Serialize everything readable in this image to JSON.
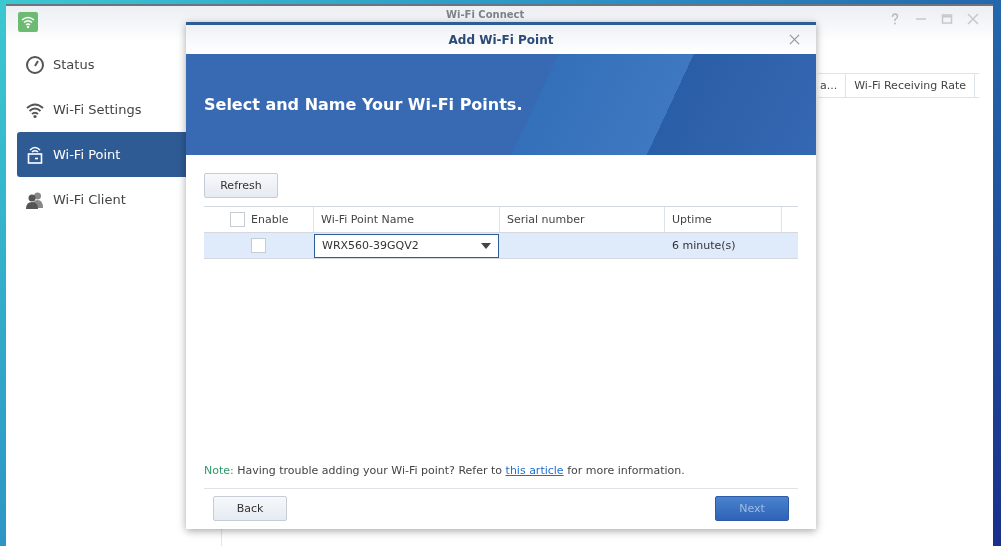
{
  "window": {
    "title": "Wi-Fi Connect"
  },
  "sidebar": {
    "items": [
      {
        "label": "Status",
        "selected": false
      },
      {
        "label": "Wi-Fi Settings",
        "selected": false
      },
      {
        "label": "Wi-Fi Point",
        "selected": true
      },
      {
        "label": "Wi-Fi Client",
        "selected": false
      }
    ]
  },
  "background_table": {
    "columns": [
      "a...",
      "Wi-Fi Receiving Rate"
    ]
  },
  "dialog": {
    "title": "Add Wi-Fi Point",
    "banner": "Select and Name Your Wi-Fi Points.",
    "refresh_button": "Refresh",
    "table": {
      "select_all_checked": false,
      "columns": [
        "Enable",
        "Wi-Fi Point Name",
        "Serial number",
        "Uptime"
      ],
      "rows": [
        {
          "checked": false,
          "selected": true,
          "name": "WRX560-39GQV2",
          "uptime": "6 minute(s)"
        }
      ]
    },
    "note": {
      "label": "Note:",
      "text": "Having trouble adding your Wi-Fi point? Refer to",
      "link": "this article",
      "after": "for more information."
    },
    "buttons": [
      {
        "label": "Back",
        "kind": "secondary",
        "disabled": false
      },
      {
        "label": "Next",
        "kind": "primary",
        "disabled": true
      }
    ]
  }
}
